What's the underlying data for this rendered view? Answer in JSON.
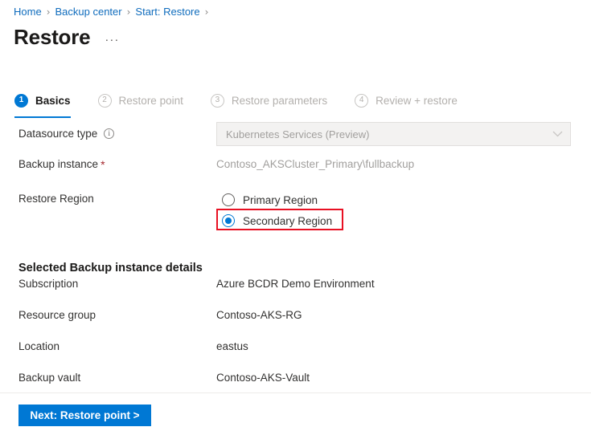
{
  "breadcrumb": {
    "separator": "›",
    "items": [
      {
        "label": "Home"
      },
      {
        "label": "Backup center"
      },
      {
        "label": "Start: Restore"
      }
    ]
  },
  "header": {
    "title": "Restore",
    "more_actions": "···"
  },
  "wizard": {
    "steps": [
      {
        "number": "1",
        "label": "Basics",
        "state": "active"
      },
      {
        "number": "2",
        "label": "Restore point",
        "state": "inactive"
      },
      {
        "number": "3",
        "label": "Restore parameters",
        "state": "inactive"
      },
      {
        "number": "4",
        "label": "Review + restore",
        "state": "inactive"
      }
    ]
  },
  "form": {
    "datasource_type": {
      "label": "Datasource type",
      "info_glyph": "i",
      "value": "Kubernetes Services (Preview)",
      "chevron": "⌄"
    },
    "backup_instance": {
      "label": "Backup instance",
      "required_marker": "*",
      "value": "Contoso_AKSCluster_Primary\\fullbackup"
    },
    "restore_region": {
      "label": "Restore Region",
      "options": [
        {
          "label": "Primary Region",
          "selected": false
        },
        {
          "label": "Secondary Region",
          "selected": true
        }
      ]
    }
  },
  "details": {
    "heading": "Selected Backup instance details",
    "rows": [
      {
        "label": "Subscription",
        "value": "Azure BCDR Demo Environment"
      },
      {
        "label": "Resource group",
        "value": "Contoso-AKS-RG"
      },
      {
        "label": "Location",
        "value": "eastus"
      },
      {
        "label": "Backup vault",
        "value": "Contoso-AKS-Vault"
      }
    ]
  },
  "footer": {
    "next_label": "Next: Restore point >"
  },
  "colors": {
    "accent": "#0078d4",
    "link": "#0f6cbd",
    "highlight": "#e81123",
    "required": "#a4262c",
    "disabled_text": "#a19f9d"
  }
}
